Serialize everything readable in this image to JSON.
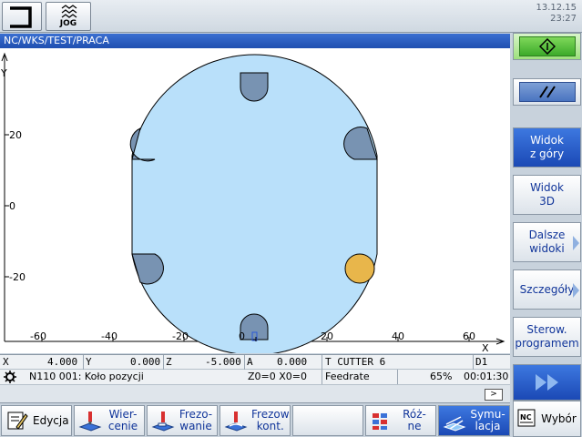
{
  "header": {
    "mode_label": "JOG",
    "date": "13.12.15",
    "time": "23:27"
  },
  "title_path": "NC/WKS/TEST/PRACA",
  "plot": {
    "x_axis_label": "X",
    "y_axis_label": "Y",
    "x_ticks": [
      "-60",
      "-40",
      "-20",
      "0",
      "20",
      "40",
      "60"
    ],
    "y_ticks": [
      "20",
      "0",
      "-20"
    ],
    "part_color": "#b9e0fa",
    "pocket_color": "#7893b2",
    "highlight_color": "#e8b64b"
  },
  "status": {
    "x_label": "X",
    "x_value": "4.000",
    "y_label": "Y",
    "y_value": "0.000",
    "z_label": "Z",
    "z_value": "-5.000",
    "a_label": "A",
    "a_value": "0.000",
    "tool": "T CUTTER 6",
    "d_number": "D1",
    "block": "N110 001: Koło pozycji",
    "offsets": "Z0=0 X0=0",
    "feedrate_label": "Feedrate",
    "feedrate_percent": "65%",
    "time": "00:01:30",
    "scroll_right": ">"
  },
  "sidebar": {
    "widok_gory": [
      "Widok",
      "z góry"
    ],
    "widok_3d": [
      "Widok",
      "3D"
    ],
    "dalsze": [
      "Dalsze",
      "widoki"
    ],
    "szczegoly": "Szczegóły",
    "sterow": [
      "Sterow.",
      "programem"
    ],
    "wybor": "Wybór"
  },
  "softkeys": {
    "edycja": "Edycja",
    "wiercenie": [
      "Wier-",
      "cenie"
    ],
    "frezowanie": [
      "Frezo-",
      "wanie"
    ],
    "frezow_kont": [
      "Frezow",
      "kont."
    ],
    "rozne": [
      "Róż-",
      "ne"
    ],
    "symulacja": [
      "Symu-",
      "lacja"
    ]
  }
}
